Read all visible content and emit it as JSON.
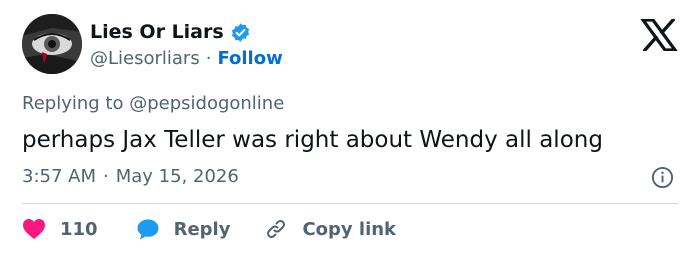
{
  "author": {
    "display_name": "Lies Or Liars",
    "handle": "@Liesorliars",
    "separator": "·",
    "follow_label": "Follow"
  },
  "reply_context": {
    "prefix": "Replying to",
    "mention": "@pepsidogonline"
  },
  "tweet": {
    "text": "perhaps Jax Teller was right about Wendy all along",
    "time": "3:57 AM",
    "separator": "·",
    "date": "May 15, 2026"
  },
  "actions": {
    "like_count": "110",
    "reply_label": "Reply",
    "copy_link_label": "Copy link"
  },
  "icons": {
    "platform": "x-logo-icon",
    "verified": "verified-badge-icon",
    "info": "info-icon",
    "like": "heart-icon",
    "reply": "speech-bubble-icon",
    "copy": "link-icon"
  },
  "colors": {
    "text": "#0f1419",
    "secondary": "#536471",
    "accent": "#006fd6",
    "verified": "#1d9bf0",
    "like": "#f91880",
    "divider": "#cfd9de"
  }
}
